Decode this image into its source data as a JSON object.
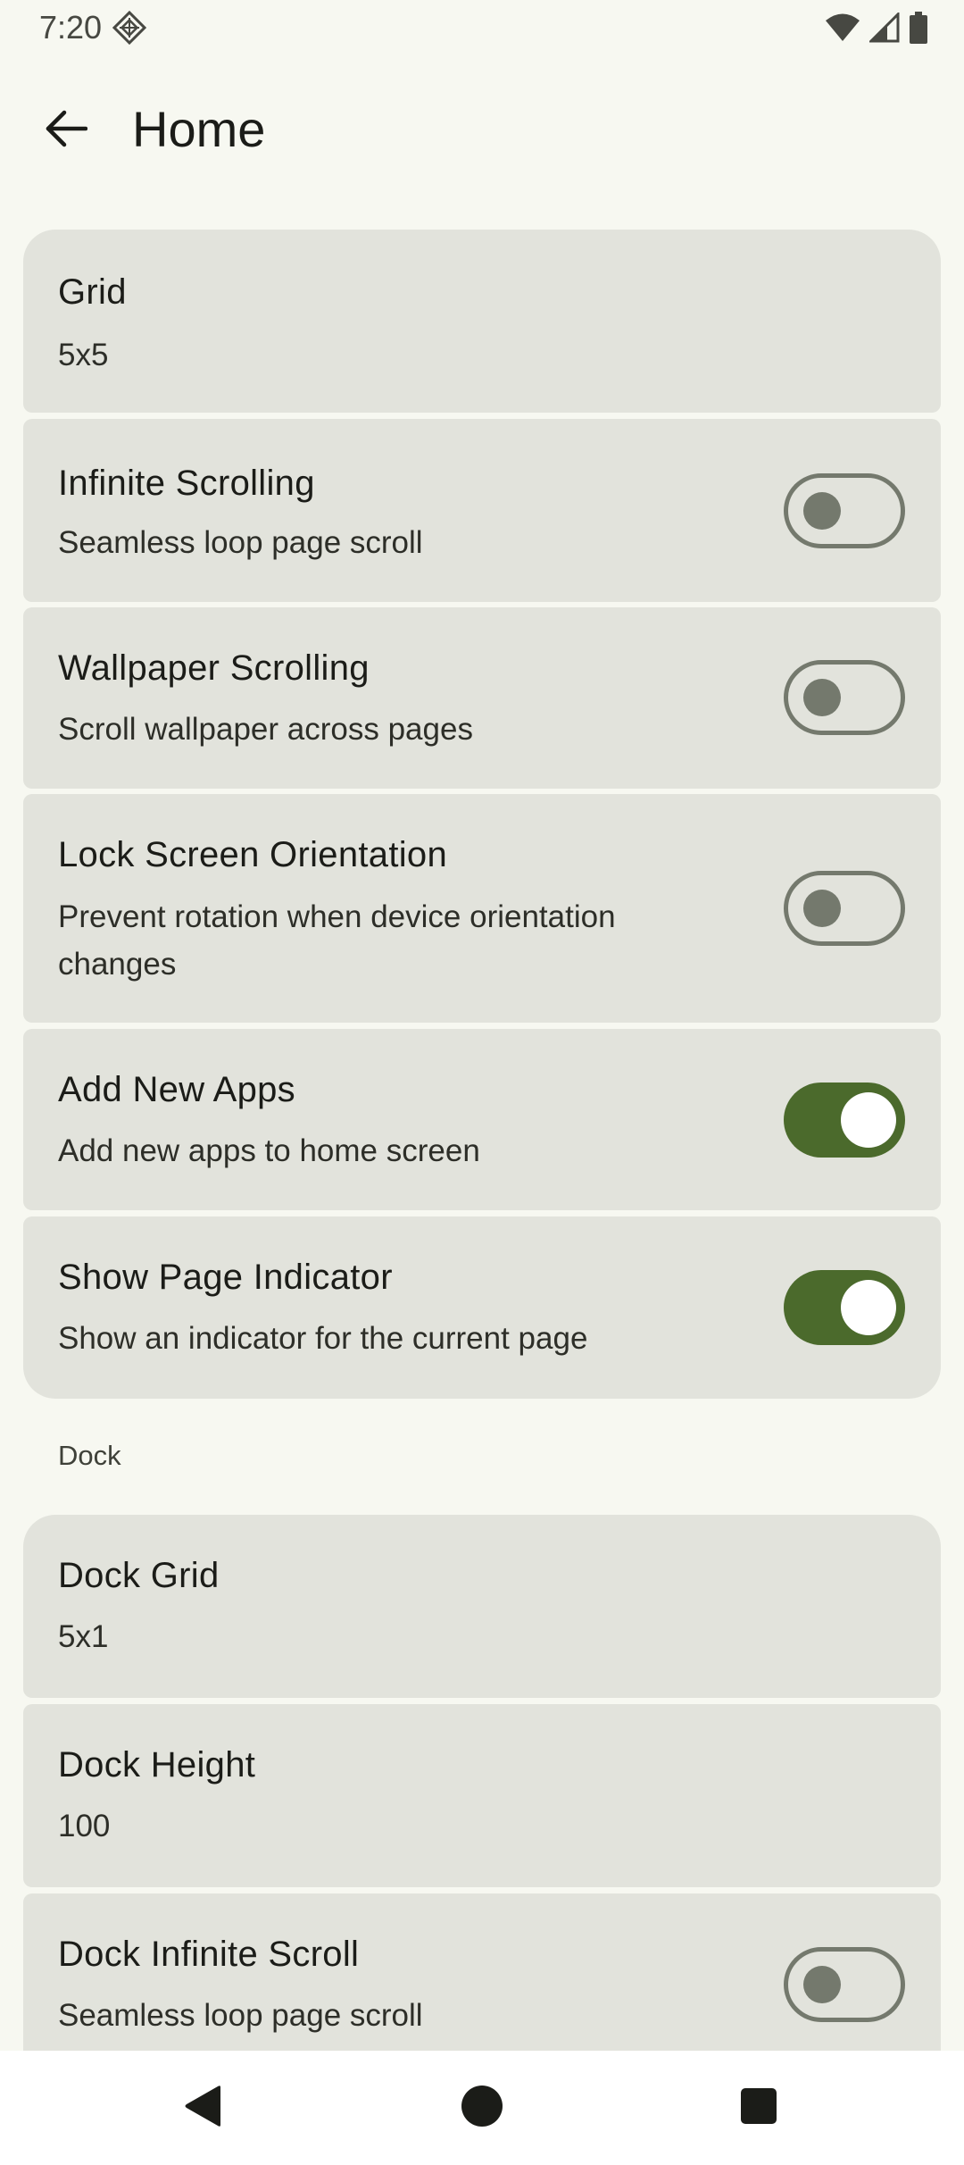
{
  "status_bar": {
    "time": "7:20",
    "icons": [
      "notification-icon",
      "wifi-icon",
      "signal-icon",
      "battery-icon"
    ]
  },
  "app_bar": {
    "back_icon": "arrow-back-icon",
    "title": "Home"
  },
  "settings": {
    "grid": {
      "title": "Grid",
      "value": "5x5"
    },
    "infinite_scrolling": {
      "title": "Infinite Scrolling",
      "subtitle": "Seamless loop page scroll",
      "enabled": false
    },
    "wallpaper_scrolling": {
      "title": "Wallpaper Scrolling",
      "subtitle": "Scroll wallpaper across pages",
      "enabled": false
    },
    "lock_orientation": {
      "title": "Lock Screen Orientation",
      "subtitle": "Prevent rotation when device orientation changes",
      "enabled": false
    },
    "add_new_apps": {
      "title": "Add New Apps",
      "subtitle": "Add new apps to home screen",
      "enabled": true
    },
    "page_indicator": {
      "title": "Show Page Indicator",
      "subtitle": "Show an indicator for the current page",
      "enabled": true
    }
  },
  "dock_section": {
    "label": "Dock",
    "dock_grid": {
      "title": "Dock Grid",
      "value": "5x1"
    },
    "dock_height": {
      "title": "Dock Height",
      "value": "100"
    },
    "dock_infinite_scroll": {
      "title": "Dock Infinite Scroll",
      "subtitle": "Seamless loop page scroll",
      "enabled": false
    }
  },
  "nav_bar": {
    "back": "nav-back-icon",
    "home": "nav-home-icon",
    "recents": "nav-recents-icon"
  },
  "colors": {
    "background": "#f7f8f1",
    "card": "#e2e3dc",
    "switch_on": "#4b6a2c",
    "switch_off_outline": "#74796d"
  }
}
